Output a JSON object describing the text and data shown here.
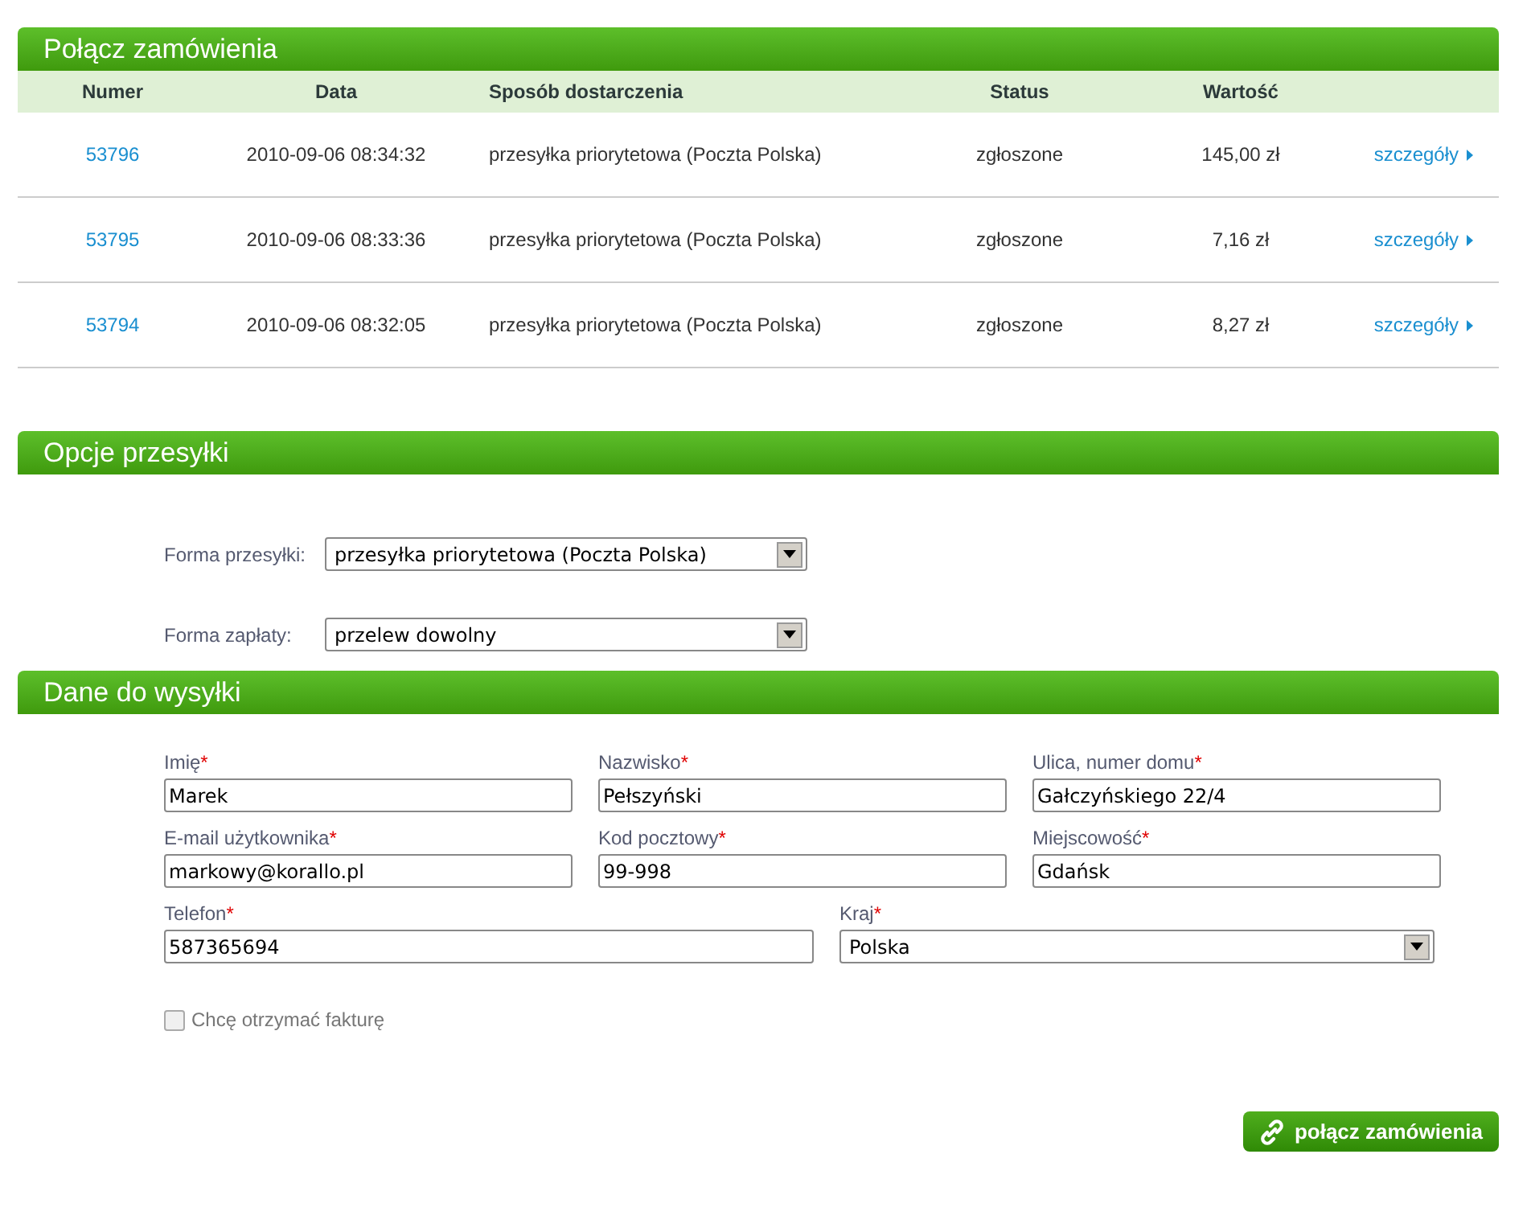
{
  "orders": {
    "title": "Połącz zamówienia",
    "columns": [
      "Numer",
      "Data",
      "Sposób dostarczenia",
      "Status",
      "Wartość"
    ],
    "rows": [
      {
        "number": "53796",
        "date": "2010-09-06 08:34:32",
        "delivery": "przesyłka priorytetowa (Poczta Polska)",
        "status": "zgłoszone",
        "value": "145,00 zł",
        "link": "szczegóły"
      },
      {
        "number": "53795",
        "date": "2010-09-06 08:33:36",
        "delivery": "przesyłka priorytetowa (Poczta Polska)",
        "status": "zgłoszone",
        "value": "7,16 zł",
        "link": "szczegóły"
      },
      {
        "number": "53794",
        "date": "2010-09-06 08:32:05",
        "delivery": "przesyłka priorytetowa (Poczta Polska)",
        "status": "zgłoszone",
        "value": "8,27 zł",
        "link": "szczegóły"
      }
    ]
  },
  "shipping_options": {
    "title": "Opcje przesyłki",
    "fields": [
      {
        "label": "Forma przesyłki:",
        "value": "przesyłka priorytetowa (Poczta Polska)"
      },
      {
        "label": "Forma zapłaty:",
        "value": "przelew dowolny"
      }
    ]
  },
  "shipping_data": {
    "title": "Dane do wysyłki",
    "rows": [
      [
        {
          "kind": "text",
          "label": "Imię",
          "mark": "*",
          "value": "Marek"
        },
        {
          "kind": "text",
          "label": "Nazwisko",
          "mark": "*",
          "value": "Pełszyński"
        },
        {
          "kind": "text",
          "label": "Ulica, numer domu",
          "mark": "*",
          "value": "Gałczyńskiego 22/4"
        }
      ],
      [
        {
          "kind": "text",
          "label": "E-mail użytkownika",
          "mark": "*",
          "value": "markowy@korallo.pl"
        },
        {
          "kind": "text",
          "label": "Kod pocztowy",
          "mark": "*",
          "value": "99-998"
        },
        {
          "kind": "text",
          "label": "Miejscowość",
          "mark": "*",
          "value": "Gdańsk"
        }
      ],
      [
        {
          "kind": "text",
          "label": "Telefon",
          "mark": "*",
          "value": "587365694"
        },
        {
          "kind": "select",
          "label": "Kraj",
          "mark": "*",
          "value": "Polska"
        }
      ]
    ],
    "invoice": {
      "label": "Chcę otrzymać fakturę",
      "checked": false
    }
  },
  "submit_button": "połącz zamówienia"
}
